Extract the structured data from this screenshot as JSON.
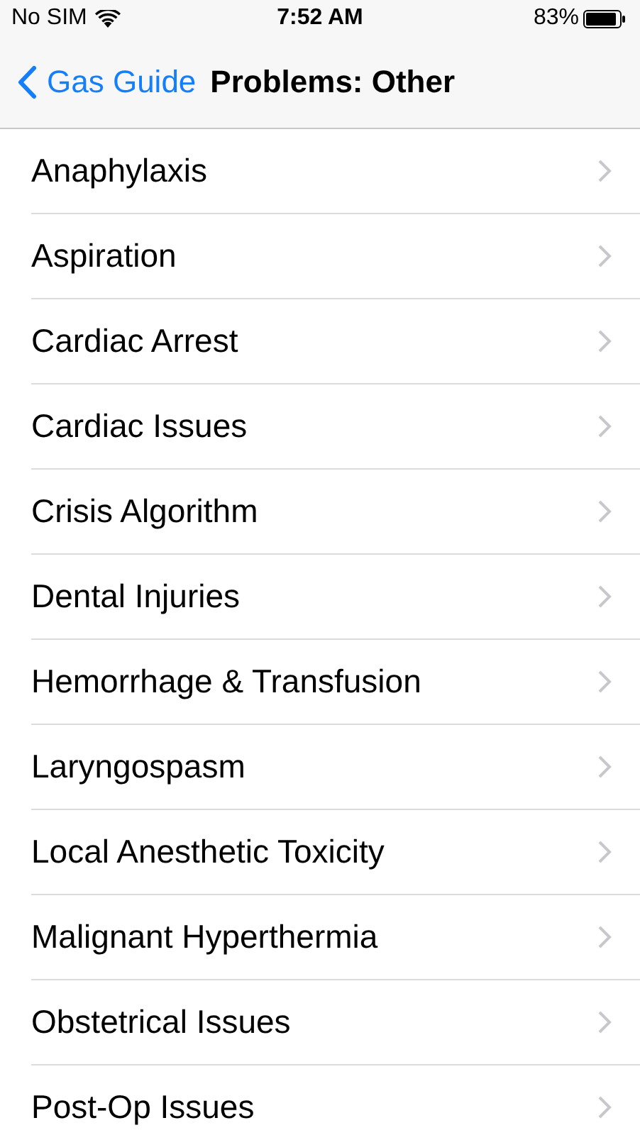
{
  "status_bar": {
    "carrier": "No SIM",
    "time": "7:52 AM",
    "battery": "83%"
  },
  "nav_bar": {
    "back": "Gas Guide",
    "title": "Problems: Other"
  },
  "items": [
    {
      "label": "Anaphylaxis"
    },
    {
      "label": "Aspiration"
    },
    {
      "label": "Cardiac Arrest"
    },
    {
      "label": "Cardiac Issues"
    },
    {
      "label": "Crisis Algorithm"
    },
    {
      "label": "Dental Injuries"
    },
    {
      "label": "Hemorrhage & Transfusion"
    },
    {
      "label": "Laryngospasm"
    },
    {
      "label": "Local Anesthetic Toxicity"
    },
    {
      "label": "Malignant Hyperthermia"
    },
    {
      "label": "Obstetrical Issues"
    },
    {
      "label": "Post-Op Issues"
    }
  ]
}
